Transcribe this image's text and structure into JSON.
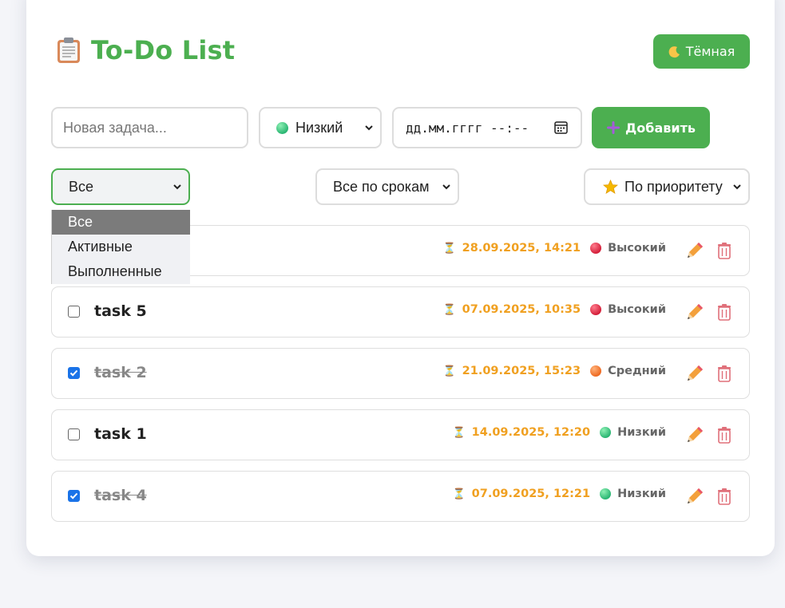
{
  "app": {
    "title": "To-Do List",
    "title_icon": "clipboard-icon",
    "theme_button": {
      "icon": "moon-icon",
      "label": "Тёмная"
    }
  },
  "form": {
    "task_placeholder": "Новая задача...",
    "priority": {
      "icon": "green-dot-icon",
      "value": "Низкий"
    },
    "date_placeholder": "дд.мм.гггг --:--",
    "add_button": {
      "icon": "plus-icon",
      "label": "Добавить"
    }
  },
  "filters": {
    "status": {
      "value": "Все",
      "options": [
        "Все",
        "Активные",
        "Выполненные"
      ],
      "highlighted": "Все"
    },
    "deadline": {
      "value": "Все по срокам"
    },
    "sort": {
      "icon": "star-icon",
      "value": "По приоритету"
    }
  },
  "tasks": [
    {
      "name": "",
      "done": false,
      "deadline": "28.09.2025, 14:21",
      "priority": "Высокий",
      "priority_color": "red"
    },
    {
      "name": "task 5",
      "done": false,
      "deadline": "07.09.2025, 10:35",
      "priority": "Высокий",
      "priority_color": "red"
    },
    {
      "name": "task 2",
      "done": true,
      "deadline": "21.09.2025, 15:23",
      "priority": "Средний",
      "priority_color": "orange"
    },
    {
      "name": "task 1",
      "done": false,
      "deadline": "14.09.2025, 12:20",
      "priority": "Низкий",
      "priority_color": "green"
    },
    {
      "name": "task 4",
      "done": true,
      "deadline": "07.09.2025, 12:21",
      "priority": "Низкий",
      "priority_color": "green"
    }
  ],
  "colors": {
    "accent": "#4caf50",
    "deadline": "#f0a020",
    "high": "#d4203b",
    "medium": "#ee6a22",
    "low": "#2bb673",
    "checkbox": "#1a73e8"
  }
}
